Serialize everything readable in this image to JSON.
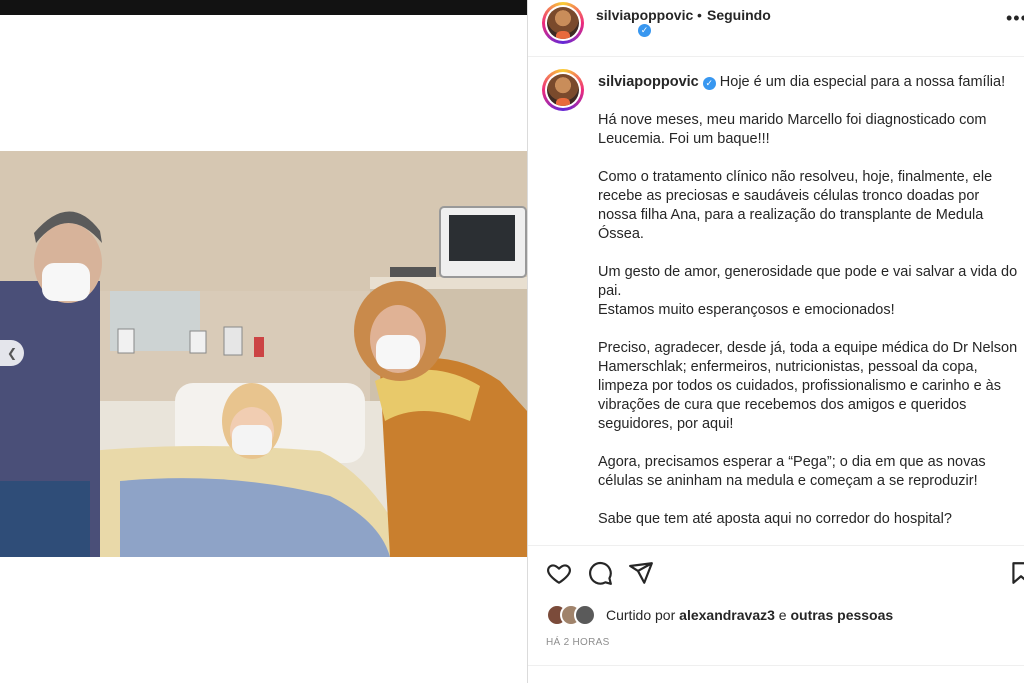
{
  "post": {
    "username": "silviapoppovic",
    "separator": "•",
    "follow_status": "Seguindo",
    "verified_badge": "✓"
  },
  "caption": {
    "username": "silviapoppovic",
    "first_line": "Hoje é um dia especial para a nossa família!",
    "paragraphs": [
      "Há nove meses, meu marido Marcello foi diagnosticado com Leucemia. Foi um baque!!!",
      "Como o tratamento clínico não resolveu, hoje, finalmente, ele recebe as preciosas e saudáveis células tronco doadas por nossa filha Ana, para a realização do transplante de Medula Óssea.",
      "Um gesto de amor, generosidade que pode e vai salvar a vida do pai.",
      "Estamos muito esperançosos e emocionados!",
      "Preciso, agradecer, desde já, toda a equipe médica do Dr Nelson Hamerschlak; enfermeiros, nutricionistas, pessoal da copa, limpeza por todos os cuidados, profissionalismo e carinho e às vibrações de cura que recebemos dos amigos e queridos seguidores, por aqui!",
      "Agora, precisamos esperar a “Pega”; o dia em que as novas células se aninham na medula e começam a se reproduzir!",
      "Sabe que tem até aposta aqui no corredor do hospital?"
    ]
  },
  "likes": {
    "prefix": "Curtido por",
    "user": "alexandravaz3",
    "connector": "e",
    "others": "outras pessoas"
  },
  "timestamp": "HÁ 2 HORAS",
  "icons": {
    "like": "heart-icon",
    "comment": "comment-icon",
    "share": "paper-plane-icon",
    "save": "bookmark-icon",
    "more": "more-horizontal-icon",
    "carousel_prev": "chevron-left-icon"
  },
  "colors": {
    "verified": "#3897f0",
    "text": "#262626",
    "muted": "#8e8e8e"
  }
}
